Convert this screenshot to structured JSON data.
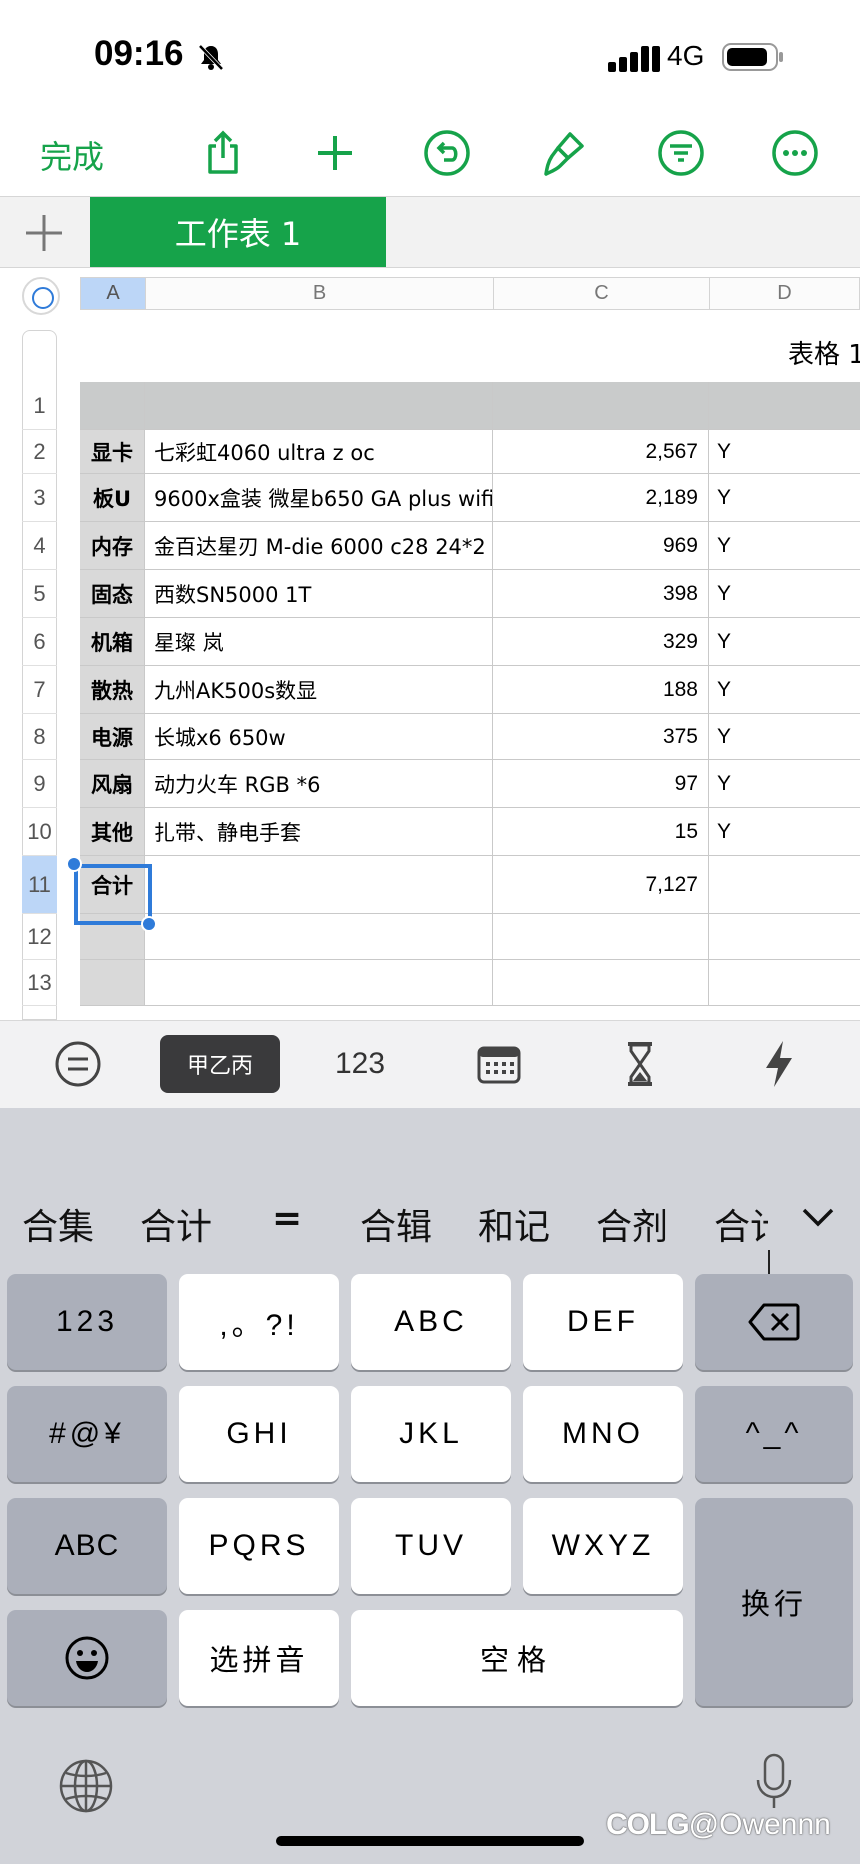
{
  "status_bar": {
    "time": "09:16",
    "network": "4G"
  },
  "toolbar": {
    "done_label": "完成"
  },
  "sheet": {
    "tab_name": "工作表 1",
    "table_title": "表格 1"
  },
  "columns": [
    "A",
    "B",
    "C",
    "D"
  ],
  "row_numbers": [
    "1",
    "2",
    "3",
    "4",
    "5",
    "6",
    "7",
    "8",
    "9",
    "10",
    "11",
    "12",
    "13"
  ],
  "rows": [
    {
      "a": "",
      "b": "",
      "c": "",
      "d": ""
    },
    {
      "a": "显卡",
      "b": "七彩虹4060 ultra z oc",
      "c": "2,567",
      "d": "Y"
    },
    {
      "a": "板U",
      "b": "9600x盒装 微星b650 GA plus wifi",
      "c": "2,189",
      "d": "Y"
    },
    {
      "a": "内存",
      "b": "金百达星刃 M-die 6000 c28 24*2",
      "c": "969",
      "d": "Y"
    },
    {
      "a": "固态",
      "b": "西数SN5000 1T",
      "c": "398",
      "d": "Y"
    },
    {
      "a": "机箱",
      "b": "星璨 岚",
      "c": "329",
      "d": "Y"
    },
    {
      "a": "散热",
      "b": "九州AK500s数显",
      "c": "188",
      "d": "Y"
    },
    {
      "a": "电源",
      "b": "长城x6 650w",
      "c": "375",
      "d": "Y"
    },
    {
      "a": "风扇",
      "b": "动力火车 RGB *6",
      "c": "97",
      "d": "Y"
    },
    {
      "a": "其他",
      "b": "扎带、静电手套",
      "c": "15",
      "d": "Y"
    },
    {
      "a": "合计",
      "b": "",
      "c": "7,127",
      "d": ""
    },
    {
      "a": "",
      "b": "",
      "c": "",
      "d": ""
    },
    {
      "a": "",
      "b": "",
      "c": "",
      "d": ""
    }
  ],
  "selected_cell": "A11",
  "input_bar": {
    "text_mode_label": "甲乙丙",
    "number_mode_label": "123"
  },
  "keyboard": {
    "candidates": [
      "合集",
      "合计",
      "=",
      "合辑",
      "和记",
      "合剂",
      "合计"
    ],
    "keys": {
      "num": "123",
      "punct": ",。?!",
      "abc": "ABC",
      "def": "DEF",
      "symbols": "#@¥",
      "ghi": "GHI",
      "jkl": "JKL",
      "mno": "MNO",
      "emoticon": "^_^",
      "abc_mode": "ABC",
      "pqrs": "PQRS",
      "tuv": "TUV",
      "wxyz": "WXYZ",
      "return": "换行",
      "pinyin": "选拼音",
      "space": "空格"
    }
  },
  "watermark": "@Owennn",
  "colors": {
    "accent_green": "#16a34a",
    "selection_blue": "#2f7bd9"
  }
}
